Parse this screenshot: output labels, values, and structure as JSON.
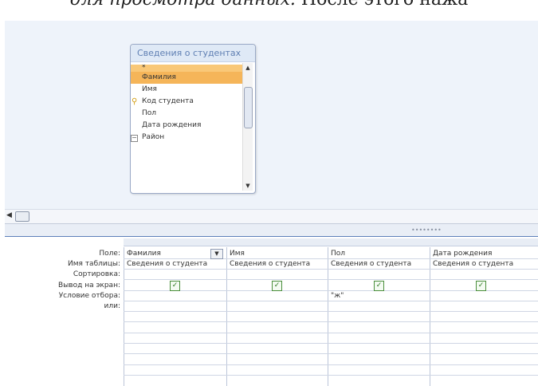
{
  "document": {
    "italic_text": "для просмотра данных.",
    "plain_text": "После этого нажа"
  },
  "table_box": {
    "title": "Сведения о студентах",
    "fields": [
      {
        "label": "*",
        "state": "selected-light"
      },
      {
        "label": "Фамилия",
        "state": "selected"
      },
      {
        "label": "Имя",
        "state": "normal"
      },
      {
        "label": "Код студента",
        "state": "key"
      },
      {
        "label": "Пол",
        "state": "normal"
      },
      {
        "label": "Дата рождения",
        "state": "normal"
      },
      {
        "label": "Район",
        "state": "expandable"
      }
    ]
  },
  "grid": {
    "row_labels": [
      "Поле:",
      "Имя таблицы:",
      "Сортировка:",
      "Вывод на экран:",
      "Условие отбора:",
      "или:"
    ],
    "columns": [
      {
        "field": "Фамилия",
        "table": "Сведения о студента",
        "show": true,
        "criteria": ""
      },
      {
        "field": "Имя",
        "table": "Сведения о студента",
        "show": true,
        "criteria": ""
      },
      {
        "field": "Пол",
        "table": "Сведения о студента",
        "show": true,
        "criteria": "\"ж\""
      },
      {
        "field": "Дата рождения",
        "table": "Сведения о студента",
        "show": true,
        "criteria": ""
      }
    ]
  },
  "icons": {
    "checkbox": "check-icon",
    "dropdown": "chevron-down-icon",
    "key": "key-icon",
    "expand": "expand-icon"
  },
  "colors": {
    "selected_field": "#f5b559",
    "design_background": "#eef3fa",
    "splitter_border": "#5d7fb9"
  }
}
